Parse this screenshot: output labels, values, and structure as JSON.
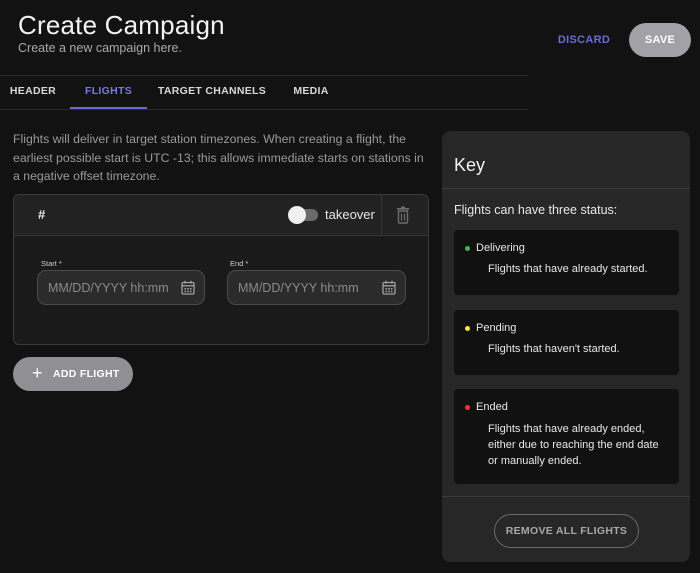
{
  "header": {
    "title": "Create Campaign",
    "subtitle": "Create a new campaign here.",
    "discard_label": "DISCARD",
    "save_label": "SAVE"
  },
  "tabs": [
    {
      "label": "HEADER",
      "active": false
    },
    {
      "label": "FLIGHTS",
      "active": true
    },
    {
      "label": "TARGET CHANNELS",
      "active": false
    },
    {
      "label": "MEDIA",
      "active": false
    }
  ],
  "flights": {
    "intro": "Flights will deliver in target station timezones. When creating a flight, the earliest possible start is UTC -13; this allows immediate starts on stations in a negative offset timezone.",
    "card": {
      "number": "#",
      "takeover_label": "takeover",
      "takeover_on": false,
      "start_label": "Start *",
      "start_placeholder": "MM/DD/YYYY hh:mm",
      "start_value": "",
      "end_label": "End *",
      "end_placeholder": "MM/DD/YYYY hh:mm",
      "end_value": ""
    },
    "add_label": "ADD FLIGHT"
  },
  "key": {
    "title": "Key",
    "subtitle": "Flights can have three status:",
    "statuses": [
      {
        "name": "Delivering",
        "desc": "Flights that have already started.",
        "color": "#4caf50"
      },
      {
        "name": "Pending",
        "desc": "Flights that haven't started.",
        "color": "#f5e642"
      },
      {
        "name": "Ended",
        "desc": "Flights that have already ended, either due to reaching the end date or manually ended.",
        "color": "#e53935"
      }
    ],
    "remove_all_label": "REMOVE ALL FLIGHTS"
  },
  "icons": {
    "delete": "trash-icon",
    "calendar": "calendar-icon",
    "add": "plus-icon"
  }
}
